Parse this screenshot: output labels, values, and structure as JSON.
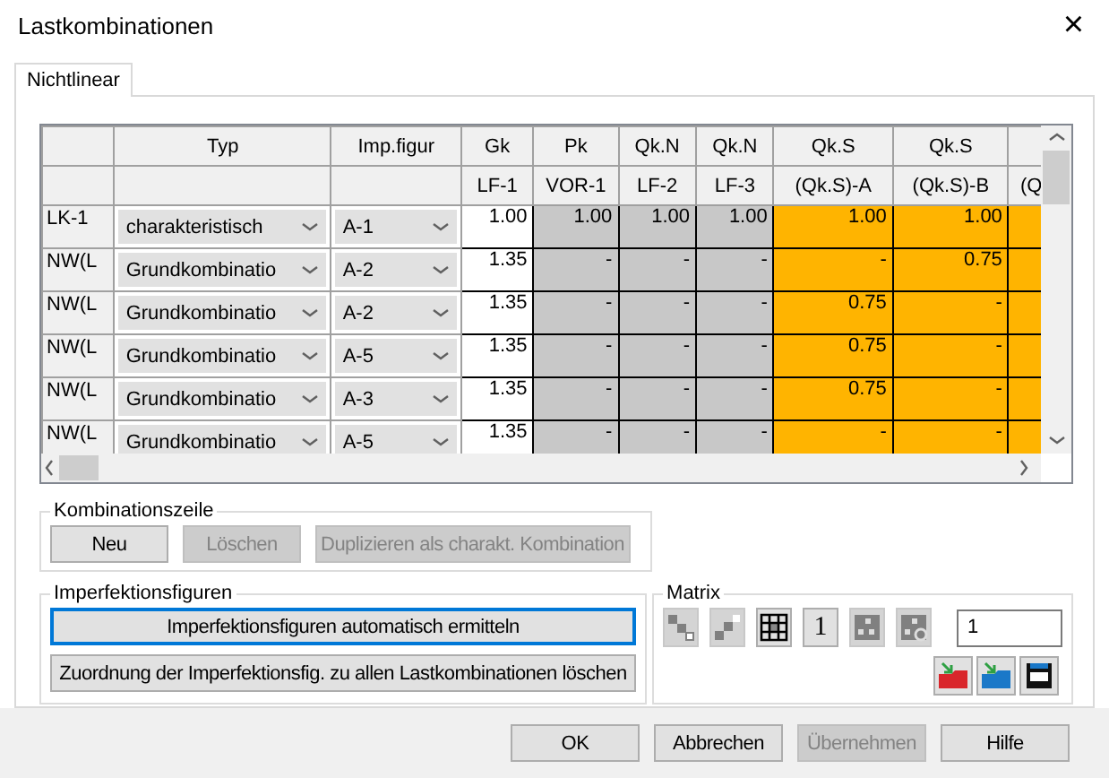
{
  "window": {
    "title": "Lastkombinationen",
    "close": "×"
  },
  "tabs": [
    {
      "label": "Nichtlinear",
      "selected": true
    }
  ],
  "table": {
    "columns": [
      {
        "kind": "select",
        "h1": "Typ"
      },
      {
        "kind": "select",
        "h1": "Imp.figur"
      },
      {
        "kind": "input",
        "h1": "Gk",
        "h2": "LF-1"
      },
      {
        "kind": "gray",
        "h1": "Pk",
        "h2": "VOR-1"
      },
      {
        "kind": "gray",
        "h1": "Qk.N",
        "h2": "LF-2"
      },
      {
        "kind": "gray",
        "h1": "Qk.N",
        "h2": "LF-3"
      },
      {
        "kind": "orange",
        "h1": "Qk.S",
        "h2": "(Qk.S)-A"
      },
      {
        "kind": "orange",
        "h1": "Qk.S",
        "h2": "(Qk.S)-B"
      },
      {
        "kind": "orange",
        "h2": "(Q"
      }
    ],
    "rows": [
      {
        "label": "LK-1",
        "cells": [
          "charakteristisch",
          "A-1",
          "1.00",
          "1.00",
          "1.00",
          "1.00",
          "1.00",
          "1.00",
          ""
        ]
      },
      {
        "label": "NW(L",
        "cells": [
          "Grundkombinatio",
          "A-2",
          "1.35",
          "-",
          "-",
          "-",
          "-",
          "0.75",
          ""
        ]
      },
      {
        "label": "NW(L",
        "cells": [
          "Grundkombinatio",
          "A-2",
          "1.35",
          "-",
          "-",
          "-",
          "0.75",
          "-",
          ""
        ]
      },
      {
        "label": "NW(L",
        "cells": [
          "Grundkombinatio",
          "A-5",
          "1.35",
          "-",
          "-",
          "-",
          "0.75",
          "-",
          ""
        ]
      },
      {
        "label": "NW(L",
        "cells": [
          "Grundkombinatio",
          "A-3",
          "1.35",
          "-",
          "-",
          "-",
          "0.75",
          "-",
          ""
        ]
      },
      {
        "label": "NW(L",
        "cells": [
          "Grundkombinatio",
          "A-5",
          "1.35",
          "-",
          "-",
          "-",
          "-",
          "-",
          ""
        ]
      }
    ]
  },
  "kombinationszeile": {
    "title": "Kombinationszeile",
    "buttons": [
      {
        "label": "Neu",
        "disabled": false
      },
      {
        "label": "Löschen",
        "disabled": true
      },
      {
        "label": "Duplizieren als charakt. Kombination",
        "disabled": true
      }
    ]
  },
  "imperfektionsfiguren": {
    "title": "Imperfektionsfiguren",
    "buttons": [
      {
        "label": "Imperfektionsfiguren automatisch ermitteln",
        "focused": true
      },
      {
        "label": "Zuordnung der Imperfektionsfig. zu allen Lastkombinationen löschen",
        "focused": false
      }
    ]
  },
  "matrix": {
    "title": "Matrix",
    "tools": [
      {
        "kind": "diag",
        "disabled": true
      },
      {
        "kind": "stairs",
        "disabled": true
      },
      {
        "kind": "grid",
        "disabled": false
      },
      {
        "kind": "text",
        "label": "1",
        "disabled": false
      },
      {
        "kind": "blocks",
        "disabled": true
      },
      {
        "kind": "blocks-gear",
        "disabled": true
      }
    ],
    "value": "1",
    "files": [
      {
        "kind": "folder",
        "color": "#d9262b"
      },
      {
        "kind": "folder",
        "color": "#1a78c8"
      },
      {
        "kind": "save"
      }
    ]
  },
  "footer": [
    {
      "label": "OK",
      "disabled": false
    },
    {
      "label": "Abbrechen",
      "disabled": false
    },
    {
      "label": "Übernehmen",
      "disabled": true
    },
    {
      "label": "Hilfe",
      "disabled": false
    }
  ]
}
